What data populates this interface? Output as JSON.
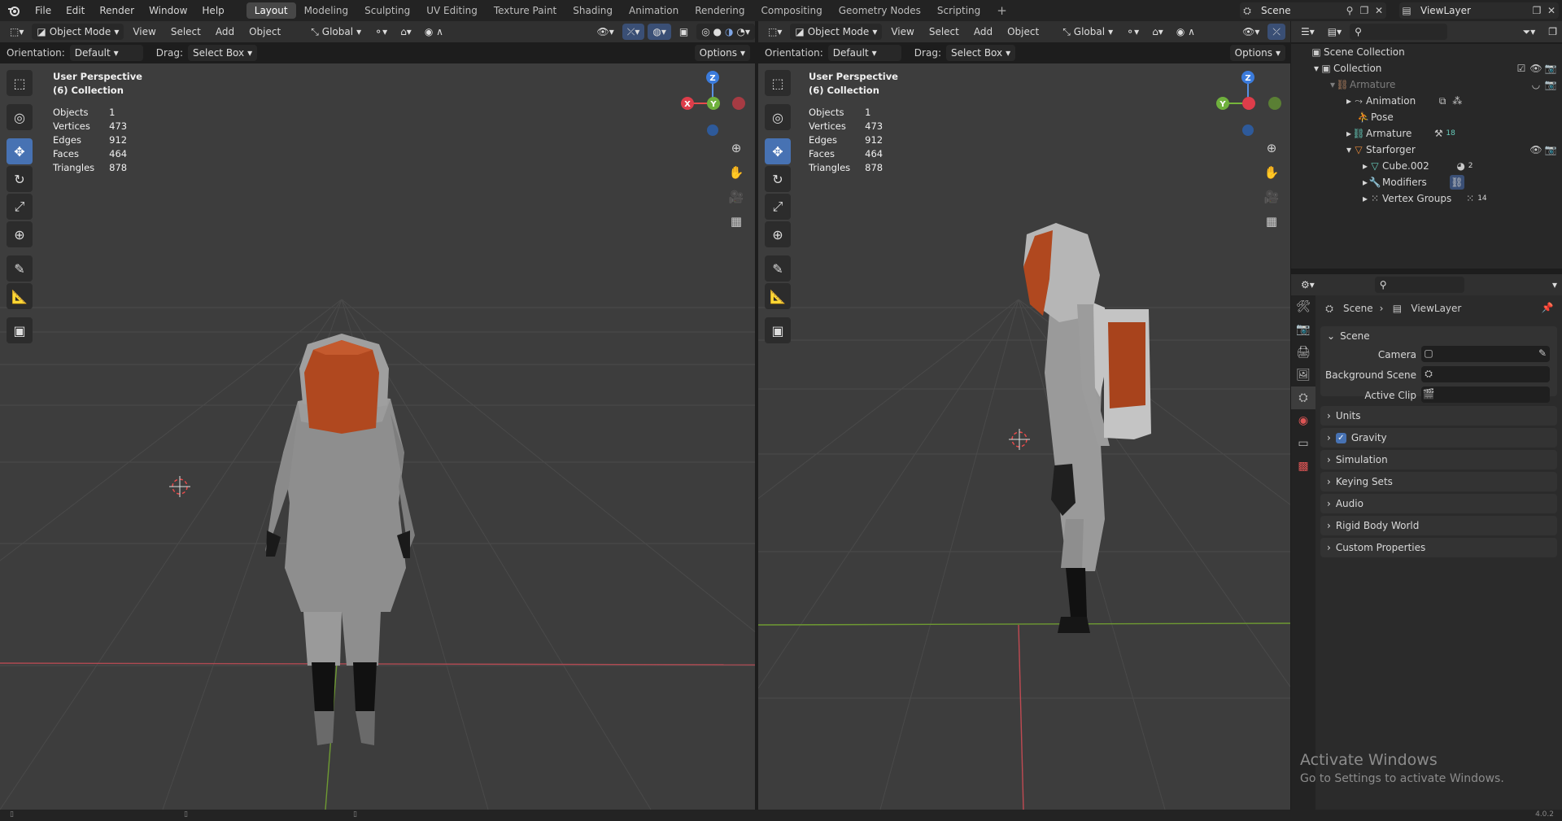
{
  "menu": [
    "File",
    "Edit",
    "Render",
    "Window",
    "Help"
  ],
  "workspaces": [
    "Layout",
    "Modeling",
    "Sculpting",
    "UV Editing",
    "Texture Paint",
    "Shading",
    "Animation",
    "Rendering",
    "Compositing",
    "Geometry Nodes",
    "Scripting"
  ],
  "active_workspace": "Layout",
  "scene_name": "Scene",
  "view_layer_name": "ViewLayer",
  "viewport_header": {
    "mode": "Object Mode",
    "menus": [
      "View",
      "Select",
      "Add",
      "Object"
    ],
    "transform": "Global"
  },
  "viewport_subheader": {
    "orientation_label": "Orientation:",
    "orientation_value": "Default",
    "drag_label": "Drag:",
    "drag_value": "Select Box",
    "options": "Options"
  },
  "viewports": [
    {
      "title": "User Perspective",
      "collection": "(6) Collection",
      "stats": [
        [
          "Objects",
          "1"
        ],
        [
          "Vertices",
          "473"
        ],
        [
          "Edges",
          "912"
        ],
        [
          "Faces",
          "464"
        ],
        [
          "Triangles",
          "878"
        ]
      ]
    },
    {
      "title": "User Perspective",
      "collection": "(6) Collection",
      "stats": [
        [
          "Objects",
          "1"
        ],
        [
          "Vertices",
          "473"
        ],
        [
          "Edges",
          "912"
        ],
        [
          "Faces",
          "464"
        ],
        [
          "Triangles",
          "878"
        ]
      ]
    }
  ],
  "gizmo_labels": {
    "z": "Z",
    "x": "X",
    "y": "Y"
  },
  "outliner": {
    "root": "Scene Collection",
    "items": [
      {
        "label": "Collection",
        "depth": 1
      },
      {
        "label": "Armature",
        "depth": 2,
        "dim": true
      },
      {
        "label": "Animation",
        "depth": 3
      },
      {
        "label": "Pose",
        "depth": 3
      },
      {
        "label": "Armature",
        "depth": 3
      },
      {
        "label": "Starforger",
        "depth": 3
      },
      {
        "label": "Cube.002",
        "depth": 4
      },
      {
        "label": "Modifiers",
        "depth": 4
      },
      {
        "label": "Vertex Groups",
        "depth": 4
      }
    ],
    "badges": {
      "armature_count": "18",
      "cube_count": "2",
      "vgroup_count": "14"
    }
  },
  "properties": {
    "breadcrumb": [
      "Scene",
      "ViewLayer"
    ],
    "scene_panel": "Scene",
    "fields": [
      {
        "label": "Camera"
      },
      {
        "label": "Background Scene"
      },
      {
        "label": "Active Clip"
      }
    ],
    "collapsed": [
      "Units",
      "Gravity",
      "Simulation",
      "Keying Sets",
      "Audio",
      "Rigid Body World",
      "Custom Properties"
    ]
  },
  "watermark": {
    "line1": "Activate Windows",
    "line2": "Go to Settings to activate Windows."
  },
  "version": "4.0.2",
  "colors": {
    "accent": "#4772b3",
    "viewport_bg": "#3d3d3d",
    "suit": "#8e8e8e",
    "visor": "#b0481f"
  }
}
